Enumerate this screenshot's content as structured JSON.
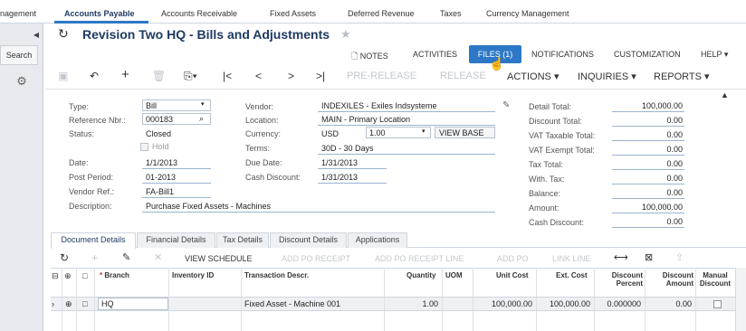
{
  "top_tabs": [
    "nagement",
    "Accounts Payable",
    "Accounts Receivable",
    "Fixed Assets",
    "Deferred Revenue",
    "Taxes",
    "Currency Management"
  ],
  "sidebar": {
    "search_label": "Search"
  },
  "title": "Revision Two HQ  -  Bills and Adjustments",
  "top_links": {
    "notes": "NOTES",
    "activities": "ACTIVITIES",
    "files": "FILES (1)",
    "notifications": "NOTIFICATIONS",
    "customization": "CUSTOMIZATION",
    "help": "HELP"
  },
  "toolbar": {
    "pre_release": "PRE-RELEASE",
    "release": "RELEASE",
    "actions": "ACTIONS",
    "inquiries": "INQUIRIES",
    "reports": "REPORTS"
  },
  "form": {
    "type_label": "Type:",
    "type_value": "Bill",
    "ref_label": "Reference Nbr.:",
    "ref_value": "000183",
    "status_label": "Status:",
    "status_value": "Closed",
    "hold_label": "Hold",
    "date_label": "Date:",
    "date_value": "1/1/2013",
    "post_label": "Post Period:",
    "post_value": "01-2013",
    "vref_label": "Vendor Ref.:",
    "vref_value": "FA-Bill1",
    "desc_label": "Description:",
    "desc_value": "Purchase Fixed Assets - Machines",
    "vendor_label": "Vendor:",
    "vendor_value": "INDEXILES - Exiles Indsysteme",
    "location_label": "Location:",
    "location_value": "MAIN - Primary Location",
    "currency_label": "Currency:",
    "currency_value": "USD",
    "rate_value": "1.00",
    "view_base": "VIEW BASE",
    "terms_label": "Terms:",
    "terms_value": "30D - 30 Days",
    "due_label": "Due Date:",
    "due_value": "1/31/2013",
    "cash_label": "Cash Discount:",
    "cash_value": "1/31/2013",
    "totals": [
      {
        "label": "Detail Total:",
        "value": "100,000.00"
      },
      {
        "label": "Discount Total:",
        "value": "0.00"
      },
      {
        "label": "VAT Taxable Total:",
        "value": "0.00"
      },
      {
        "label": "VAT Exempt Total:",
        "value": "0.00"
      },
      {
        "label": "Tax Total:",
        "value": "0.00"
      },
      {
        "label": "With. Tax:",
        "value": "0.00"
      },
      {
        "label": "Balance:",
        "value": "0.00"
      },
      {
        "label": "Amount:",
        "value": "100,000.00"
      },
      {
        "label": "Cash Discount:",
        "value": "0.00"
      }
    ]
  },
  "lower_tabs": [
    "Document Details",
    "Financial Details",
    "Tax Details",
    "Discount Details",
    "Applications"
  ],
  "grid_toolbar": {
    "view_schedule": "VIEW SCHEDULE",
    "add_po_receipt": "ADD PO RECEIPT",
    "add_po_receipt_line": "ADD PO RECEIPT LINE",
    "add_po": "ADD PO",
    "link_line": "LINK LINE"
  },
  "grid": {
    "headers": [
      "Branch",
      "Inventory ID",
      "Transaction Descr.",
      "Quantity",
      "UOM",
      "Unit Cost",
      "Ext. Cost",
      "Discount Percent",
      "Discount Amount",
      "Manual Discount"
    ],
    "row": {
      "branch": "HQ",
      "inventory": "",
      "descr": "Fixed Asset - Machine 001",
      "qty": "1.00",
      "uom": "",
      "unit_cost": "100,000.00",
      "ext_cost": "100,000.00",
      "disc_pct": "0.000000",
      "disc_amt": "0.00"
    }
  }
}
